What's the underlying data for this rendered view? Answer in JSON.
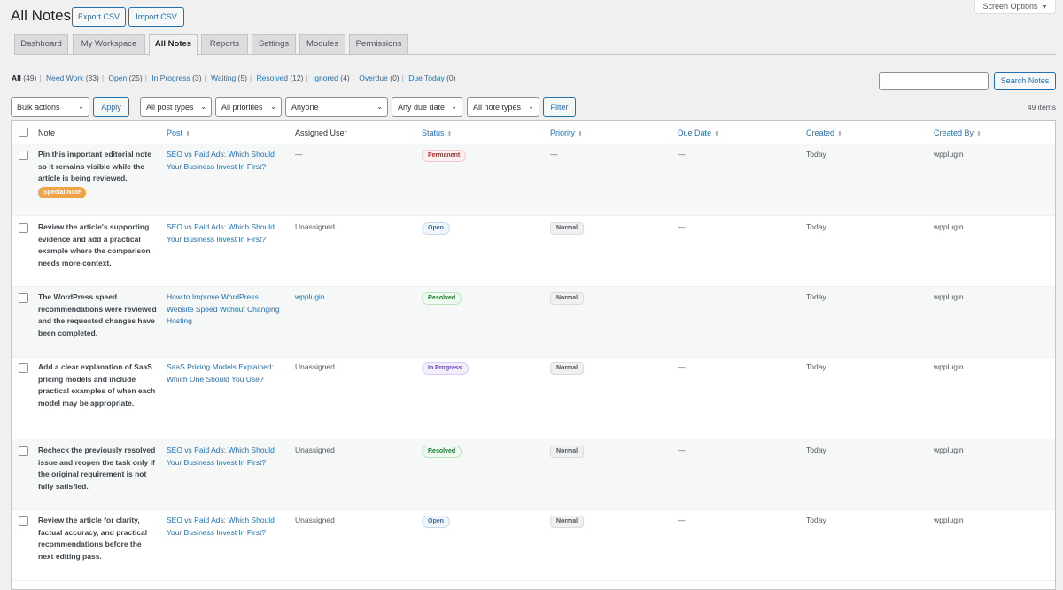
{
  "header": {
    "title": "All Notes",
    "export_label": "Export CSV",
    "import_label": "Import CSV",
    "screen_options_label": "Screen Options"
  },
  "tabs": [
    {
      "label": "Dashboard"
    },
    {
      "label": "My Workspace"
    },
    {
      "label": "All Notes",
      "active": true
    },
    {
      "label": "Reports"
    },
    {
      "label": "Settings"
    },
    {
      "label": "Modules"
    },
    {
      "label": "Permissions"
    }
  ],
  "views": [
    {
      "label": "All",
      "count": "(49)",
      "current": true
    },
    {
      "label": "Need Work",
      "count": "(33)"
    },
    {
      "label": "Open",
      "count": "(25)"
    },
    {
      "label": "In Progress",
      "count": "(3)"
    },
    {
      "label": "Waiting",
      "count": "(5)"
    },
    {
      "label": "Resolved",
      "count": "(12)"
    },
    {
      "label": "Ignored",
      "count": "(4)"
    },
    {
      "label": "Overdue",
      "count": "(0)"
    },
    {
      "label": "Due Today",
      "count": "(0)"
    }
  ],
  "search": {
    "button_label": "Search Notes",
    "value": ""
  },
  "filters": {
    "bulk_actions": "Bulk actions",
    "apply_label": "Apply",
    "post_types": "All post types",
    "priorities": "All priorities",
    "assignee": "Anyone",
    "due_date": "Any due date",
    "note_types": "All note types",
    "filter_label": "Filter",
    "items_count": "49 items"
  },
  "columns": {
    "note": "Note",
    "post": "Post",
    "assigned_user": "Assigned User",
    "status": "Status",
    "priority": "Priority",
    "due_date": "Due Date",
    "created": "Created",
    "created_by": "Created By"
  },
  "rows": [
    {
      "note": "Pin this important editorial note so it remains visible while the article is being reviewed.",
      "special_badge": "Special Note",
      "post": "SEO vs Paid Ads: Which Should Your Business Invest In First?",
      "assigned_user": "—",
      "status": "Permanent",
      "priority": "—",
      "due_date": "—",
      "created": "Today",
      "created_by": "wpplugin"
    },
    {
      "note": "Review the article's supporting evidence and add a practical example where the comparison needs more context.",
      "post": "SEO vs Paid Ads: Which Should Your Business Invest In First?",
      "assigned_user": "Unassigned",
      "status": "Open",
      "priority": "Normal",
      "due_date": "—",
      "created": "Today",
      "created_by": "wpplugin"
    },
    {
      "note": "The WordPress speed recommendations were reviewed and the requested changes have been completed.",
      "post": "How to Improve WordPress Website Speed Without Changing Hosting",
      "assigned_user": "wpplugin",
      "status": "Resolved",
      "priority": "Normal",
      "due_date": "",
      "created": "Today",
      "created_by": "wpplugin"
    },
    {
      "note": "Add a clear explanation of SaaS pricing models and include practical examples of when each model may be appropriate.",
      "post": "SaaS Pricing Models Explained: Which One Should You Use?",
      "assigned_user": "Unassigned",
      "status": "In Progress",
      "priority": "Normal",
      "due_date": "—",
      "created": "Today",
      "created_by": "wpplugin"
    },
    {
      "note": "Recheck the previously resolved issue and reopen the task only if the original requirement is not fully satisfied.",
      "post": "SEO vs Paid Ads: Which Should Your Business Invest In First?",
      "assigned_user": "Unassigned",
      "status": "Resolved",
      "priority": "Normal",
      "due_date": "—",
      "created": "Today",
      "created_by": "wpplugin"
    },
    {
      "note": "Review the article for clarity, factual accuracy, and practical recommendations before the next editing pass.",
      "post": "SEO vs Paid Ads: Which Should Your Business Invest In First?",
      "assigned_user": "Unassigned",
      "status": "Open",
      "priority": "Normal",
      "due_date": "—",
      "created": "Today",
      "created_by": "wpplugin"
    }
  ]
}
